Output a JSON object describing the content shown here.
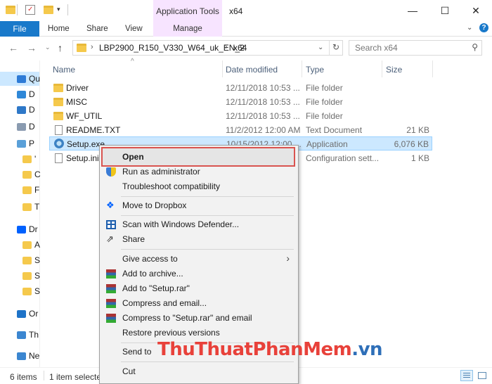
{
  "window": {
    "context_tab": "Application Tools",
    "title": "x64",
    "minimize_glyph": "—",
    "maximize_glyph": "☐",
    "close_glyph": "✕"
  },
  "ribbon": {
    "file": "File",
    "tabs": [
      "Home",
      "Share",
      "View"
    ],
    "manage": "Manage"
  },
  "address": {
    "path": [
      "LBP2900_R150_V330_W64_uk_EN_2",
      "x64"
    ],
    "search_placeholder": "Search x64"
  },
  "nav_pane": {
    "items": [
      {
        "icon": "star-icon",
        "label": "Qu"
      },
      {
        "icon": "desktop-icon",
        "label": "D"
      },
      {
        "icon": "download-icon",
        "label": "D"
      },
      {
        "icon": "document-icon",
        "label": "D"
      },
      {
        "icon": "picture-icon",
        "label": "P"
      },
      {
        "icon": "folder-icon",
        "label": "'"
      },
      {
        "icon": "folder-icon",
        "label": "C"
      },
      {
        "icon": "folder-icon",
        "label": "F"
      },
      {
        "icon": "folder-icon",
        "label": "T"
      },
      {
        "icon": "dropbox-icon",
        "label": "Dr"
      },
      {
        "icon": "folder-icon",
        "label": "A"
      },
      {
        "icon": "folder-icon",
        "label": "S"
      },
      {
        "icon": "folder-icon",
        "label": "S"
      },
      {
        "icon": "folder-icon",
        "label": "S"
      },
      {
        "icon": "onedrive-icon",
        "label": "Or"
      },
      {
        "icon": "pc-icon",
        "label": "Th"
      },
      {
        "icon": "network-icon",
        "label": "Ne"
      }
    ]
  },
  "columns": {
    "name": "Name",
    "date": "Date modified",
    "type": "Type",
    "size": "Size"
  },
  "files": [
    {
      "name": "Driver",
      "date": "12/11/2018 10:53 ...",
      "type": "File folder",
      "size": "",
      "icon": "folder-icon"
    },
    {
      "name": "MISC",
      "date": "12/11/2018 10:53 ...",
      "type": "File folder",
      "size": "",
      "icon": "folder-icon"
    },
    {
      "name": "WF_UTIL",
      "date": "12/11/2018 10:53 ...",
      "type": "File folder",
      "size": "",
      "icon": "folder-icon"
    },
    {
      "name": "README.TXT",
      "date": "11/2/2012 12:00 AM",
      "type": "Text Document",
      "size": "21 KB",
      "icon": "text-file-icon"
    },
    {
      "name": "Setup.exe",
      "date": "10/15/2012 12:00 ...",
      "type": "Application",
      "size": "6,076 KB",
      "icon": "setup-icon"
    },
    {
      "name": "Setup.ini",
      "date": "",
      "type": "Configuration sett...",
      "size": "1 KB",
      "icon": "ini-file-icon"
    }
  ],
  "context_menu": {
    "open": "Open",
    "run_as_admin": "Run as administrator",
    "troubleshoot": "Troubleshoot compatibility",
    "dropbox": "Move to Dropbox",
    "defender": "Scan with Windows Defender...",
    "share": "Share",
    "give_access": "Give access to",
    "add_archive": "Add to archive...",
    "add_rar": "Add to \"Setup.rar\"",
    "compress_email": "Compress and email...",
    "compress_rar_email": "Compress to \"Setup.rar\" and email",
    "restore": "Restore previous versions",
    "send_to": "Send to",
    "cut": "Cut"
  },
  "status": {
    "items": "6 items",
    "selected": "1 item selected"
  },
  "watermark": {
    "part1": "ThuThuat",
    "part2": "PhanMem",
    "part3": ".vn"
  },
  "colors": {
    "accent": "#1979ca",
    "selection": "#cce8ff",
    "context_tab": "#f7e4ff",
    "highlight_border": "#d9534f"
  }
}
